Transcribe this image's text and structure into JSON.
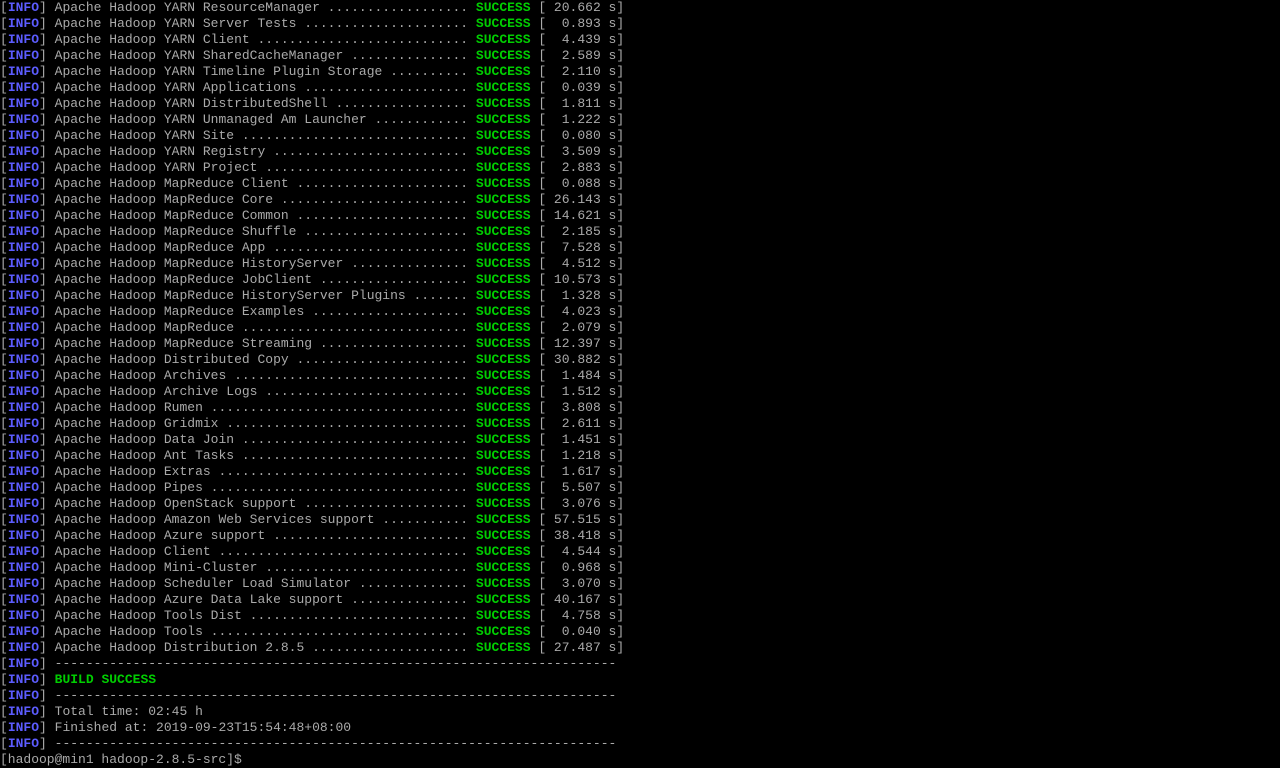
{
  "info_label": "INFO",
  "success_label": "SUCCESS",
  "modules": [
    {
      "name": "Apache Hadoop YARN ResourceManager",
      "time": "20.662"
    },
    {
      "name": "Apache Hadoop YARN Server Tests",
      "time": "0.893"
    },
    {
      "name": "Apache Hadoop YARN Client",
      "time": "4.439"
    },
    {
      "name": "Apache Hadoop YARN SharedCacheManager",
      "time": "2.589"
    },
    {
      "name": "Apache Hadoop YARN Timeline Plugin Storage",
      "time": "2.110"
    },
    {
      "name": "Apache Hadoop YARN Applications",
      "time": "0.039"
    },
    {
      "name": "Apache Hadoop YARN DistributedShell",
      "time": "1.811"
    },
    {
      "name": "Apache Hadoop YARN Unmanaged Am Launcher",
      "time": "1.222"
    },
    {
      "name": "Apache Hadoop YARN Site",
      "time": "0.080"
    },
    {
      "name": "Apache Hadoop YARN Registry",
      "time": "3.509"
    },
    {
      "name": "Apache Hadoop YARN Project",
      "time": "2.883"
    },
    {
      "name": "Apache Hadoop MapReduce Client",
      "time": "0.088"
    },
    {
      "name": "Apache Hadoop MapReduce Core",
      "time": "26.143"
    },
    {
      "name": "Apache Hadoop MapReduce Common",
      "time": "14.621"
    },
    {
      "name": "Apache Hadoop MapReduce Shuffle",
      "time": "2.185"
    },
    {
      "name": "Apache Hadoop MapReduce App",
      "time": "7.528"
    },
    {
      "name": "Apache Hadoop MapReduce HistoryServer",
      "time": "4.512"
    },
    {
      "name": "Apache Hadoop MapReduce JobClient",
      "time": "10.573"
    },
    {
      "name": "Apache Hadoop MapReduce HistoryServer Plugins",
      "time": "1.328"
    },
    {
      "name": "Apache Hadoop MapReduce Examples",
      "time": "4.023"
    },
    {
      "name": "Apache Hadoop MapReduce",
      "time": "2.079"
    },
    {
      "name": "Apache Hadoop MapReduce Streaming",
      "time": "12.397"
    },
    {
      "name": "Apache Hadoop Distributed Copy",
      "time": "30.882"
    },
    {
      "name": "Apache Hadoop Archives",
      "time": "1.484"
    },
    {
      "name": "Apache Hadoop Archive Logs",
      "time": "1.512"
    },
    {
      "name": "Apache Hadoop Rumen",
      "time": "3.808"
    },
    {
      "name": "Apache Hadoop Gridmix",
      "time": "2.611"
    },
    {
      "name": "Apache Hadoop Data Join",
      "time": "1.451"
    },
    {
      "name": "Apache Hadoop Ant Tasks",
      "time": "1.218"
    },
    {
      "name": "Apache Hadoop Extras",
      "time": "1.617"
    },
    {
      "name": "Apache Hadoop Pipes",
      "time": "5.507"
    },
    {
      "name": "Apache Hadoop OpenStack support",
      "time": "3.076"
    },
    {
      "name": "Apache Hadoop Amazon Web Services support",
      "time": "57.515"
    },
    {
      "name": "Apache Hadoop Azure support",
      "time": "38.418"
    },
    {
      "name": "Apache Hadoop Client",
      "time": "4.544"
    },
    {
      "name": "Apache Hadoop Mini-Cluster",
      "time": "0.968"
    },
    {
      "name": "Apache Hadoop Scheduler Load Simulator",
      "time": "3.070"
    },
    {
      "name": "Apache Hadoop Azure Data Lake support",
      "time": "40.167"
    },
    {
      "name": "Apache Hadoop Tools Dist",
      "time": "4.758"
    },
    {
      "name": "Apache Hadoop Tools",
      "time": "0.040"
    },
    {
      "name": "Apache Hadoop Distribution 2.8.5",
      "time": "27.487"
    }
  ],
  "separator": "------------------------------------------------------------------------",
  "build_success": "BUILD SUCCESS",
  "total_time_label": "Total time: 02:45 h",
  "finished_at_label": "Finished at: 2019-09-23T15:54:48+08:00",
  "prompt": "[hadoop@min1 hadoop-2.8.5-src]$ "
}
